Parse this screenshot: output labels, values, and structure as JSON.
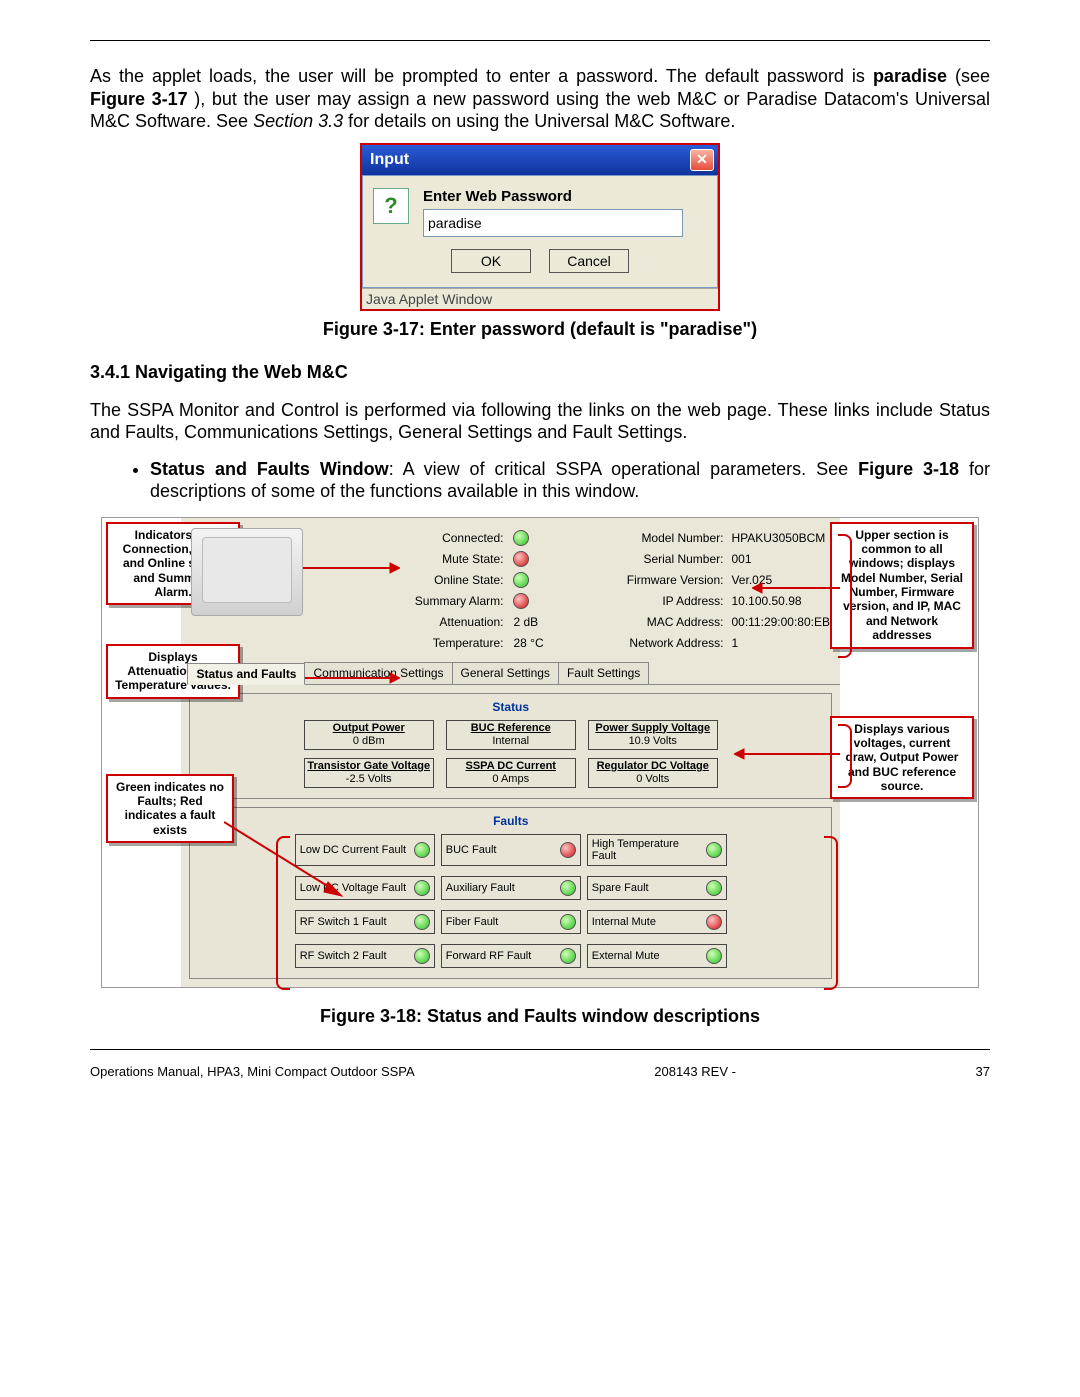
{
  "intro_text": {
    "p1a": "As the applet loads, the user will be prompted to enter a password. The default password is ",
    "p1_bold1": "paradise",
    "p1_mid1": " (see ",
    "p1_bold2": "Figure 3-17",
    "p1_mid2": "), but the user may assign a new password using the web M&C or Paradise Datacom's Universal M&C Software. See ",
    "p1_ital": "Section 3.3",
    "p1_end": " for details on using the Universal M&C Software."
  },
  "dialog": {
    "title": "Input",
    "label": "Enter Web Password",
    "value": "paradise",
    "ok": "OK",
    "cancel": "Cancel",
    "status": "Java Applet Window"
  },
  "fig17_caption": "Figure 3-17: Enter password (default is \"paradise\")",
  "section_heading": "3.4.1 Navigating the Web M&C",
  "p2": "The SSPA Monitor and Control is performed via following the links on the web page. These links include Status and Faults, Communications Settings, General Settings and Fault Settings.",
  "bullet": {
    "b1_bold": "Status and Faults Window",
    "b1_rest": ": A view of critical SSPA operational parameters. See ",
    "b1_ref": "Figure 3-18",
    "b1_end": " for descriptions of some of the functions available in this window."
  },
  "callouts": {
    "c1": "Indicators for Connection, Mute and Online states and Summary Alarm.",
    "c2": "Displays Attenuation and Temperature values.",
    "c3": "Green indicates no Faults; Red indicates a fault exists",
    "c4": "Upper section is common to all windows; displays Model Number, Serial Number, Firmware version, and IP, MAC and Network addresses",
    "c5": "Displays various voltages, current draw, Output Power and BUC reference source."
  },
  "top_kv": {
    "left": [
      {
        "k": "Connected:",
        "led": "green"
      },
      {
        "k": "Mute State:",
        "led": "red"
      },
      {
        "k": "Online State:",
        "led": "green"
      },
      {
        "k": "Summary Alarm:",
        "led": "red"
      },
      {
        "k": "Attenuation:",
        "v": "2 dB"
      },
      {
        "k": "Temperature:",
        "v": "28 °C"
      }
    ],
    "right": [
      {
        "k": "Model Number:",
        "v": "HPAKU3050BCM"
      },
      {
        "k": "Serial Number:",
        "v": "001"
      },
      {
        "k": "Firmware Version:",
        "v": "Ver.025"
      },
      {
        "k": "IP Address:",
        "v": "10.100.50.98"
      },
      {
        "k": "MAC Address:",
        "v": "00:11:29:00:80:EB"
      },
      {
        "k": "Network Address:",
        "v": "1"
      }
    ]
  },
  "tabs": [
    "Status and Faults",
    "Communication Settings",
    "General Settings",
    "Fault Settings"
  ],
  "status_title": "Status",
  "status_boxes": [
    {
      "name": "Output Power",
      "val": "0 dBm"
    },
    {
      "name": "BUC Reference",
      "val": "Internal"
    },
    {
      "name": "Power Supply Voltage",
      "val": "10.9 Volts"
    },
    {
      "name": "Transistor Gate Voltage",
      "val": "-2.5 Volts"
    },
    {
      "name": "SSPA DC Current",
      "val": "0 Amps"
    },
    {
      "name": "Regulator DC Voltage",
      "val": "0 Volts"
    }
  ],
  "faults_title": "Faults",
  "fault_boxes": [
    {
      "name": "Low DC Current Fault",
      "led": "green"
    },
    {
      "name": "BUC Fault",
      "led": "red"
    },
    {
      "name": "High Temperature Fault",
      "led": "green"
    },
    {
      "name": "Low DC Voltage Fault",
      "led": "green"
    },
    {
      "name": "Auxiliary Fault",
      "led": "green"
    },
    {
      "name": "Spare Fault",
      "led": "green"
    },
    {
      "name": "RF Switch 1 Fault",
      "led": "green"
    },
    {
      "name": "Fiber Fault",
      "led": "green"
    },
    {
      "name": "Internal Mute",
      "led": "red"
    },
    {
      "name": "RF Switch 2 Fault",
      "led": "green"
    },
    {
      "name": "Forward RF Fault",
      "led": "green"
    },
    {
      "name": "External Mute",
      "led": "green"
    }
  ],
  "fig18_caption": "Figure 3-18: Status and Faults window descriptions",
  "footer": {
    "left": "Operations Manual, HPA3, Mini Compact Outdoor SSPA",
    "center": "208143 REV -",
    "right": "37"
  }
}
